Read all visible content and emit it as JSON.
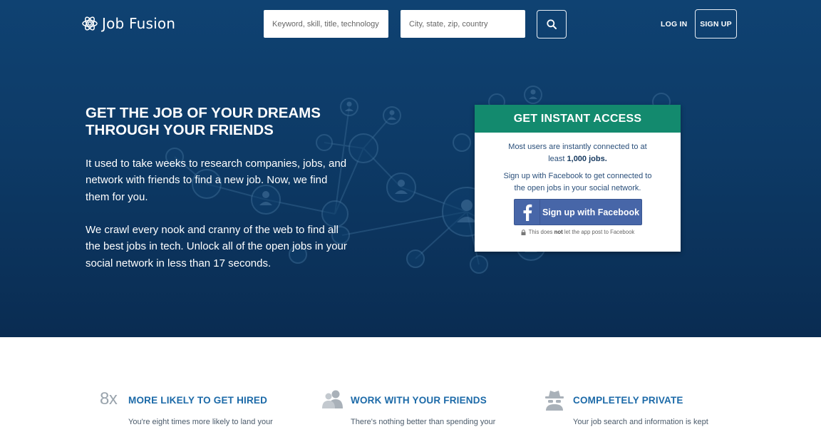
{
  "header": {
    "logo_text": "Job Fusion",
    "keyword_placeholder": "Keyword, skill, title, technology",
    "location_placeholder": "City, state, zip, country",
    "login_label": "LOG IN",
    "signup_label": "SIGN UP"
  },
  "hero": {
    "headline": "GET THE JOB OF YOUR DREAMS THROUGH YOUR FRIENDS",
    "paragraph_1": "It used to take weeks to research companies, jobs, and network with friends to find a new job. Now, we find them for you.",
    "paragraph_2": "We crawl every nook and cranny of the web to find all the best jobs in tech. Unlock all of the open jobs in your social network in less than 17 seconds."
  },
  "card": {
    "title": "GET INSTANT ACCESS",
    "line_1_pre": "Most users are instantly connected to at least ",
    "line_1_strong": "1,000 jobs.",
    "line_2": "Sign up with Facebook to get connected to the open jobs in your social network.",
    "fb_button": "Sign up with Facebook",
    "note_pre": "This does ",
    "note_strong": "not",
    "note_post": " let the app post to Facebook"
  },
  "features": [
    {
      "icon_text": "8x",
      "title": "MORE LIKELY TO GET HIRED",
      "text": "You're eight times more likely to land your"
    },
    {
      "icon": "people-icon",
      "title": "WORK WITH YOUR FRIENDS",
      "text": "There's nothing better than spending your"
    },
    {
      "icon": "spy-icon",
      "title": "COMPLETELY PRIVATE",
      "text": "Your job search and information is kept"
    }
  ],
  "colors": {
    "hero_bg": "#0d3a66",
    "card_header": "#138a6e",
    "facebook": "#4766a8",
    "feature_title": "#1c6aa8"
  }
}
